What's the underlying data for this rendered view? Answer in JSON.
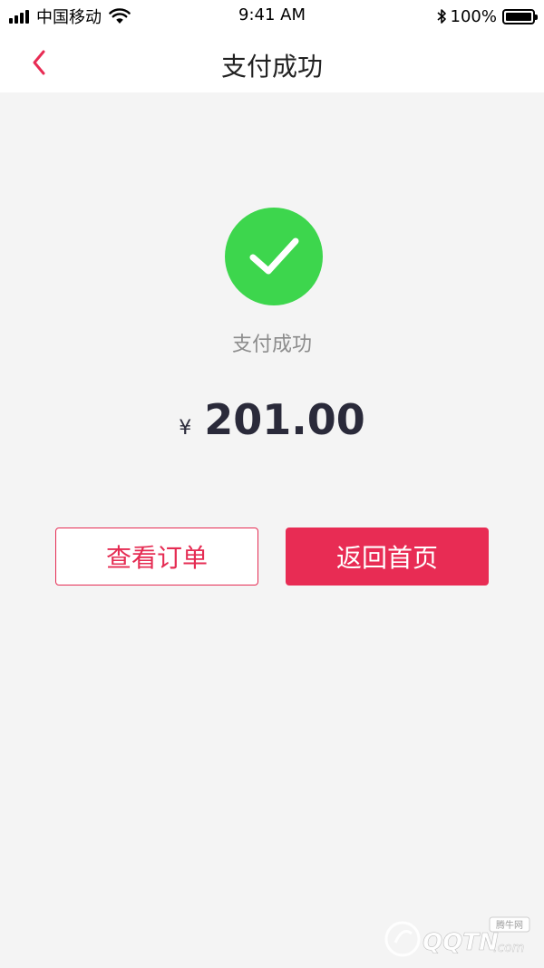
{
  "status_bar": {
    "carrier": "中国移动",
    "time": "9:41 AM",
    "battery": "100%",
    "icons": [
      "signal-icon",
      "wifi-icon",
      "bluetooth-icon",
      "battery-icon"
    ]
  },
  "nav": {
    "title": "支付成功",
    "back_icon": "chevron-left-icon",
    "accent_color": "#e82c54"
  },
  "result": {
    "icon": "check-circle-icon",
    "icon_color": "#3dd64d",
    "status_text": "支付成功",
    "currency_symbol": "¥",
    "amount": "201.00"
  },
  "actions": {
    "view_order_label": "查看订单",
    "go_home_label": "返回首页"
  },
  "watermark": {
    "brand_text": "QQTN",
    "domain_suffix": ".com",
    "tag": "腾牛网"
  }
}
